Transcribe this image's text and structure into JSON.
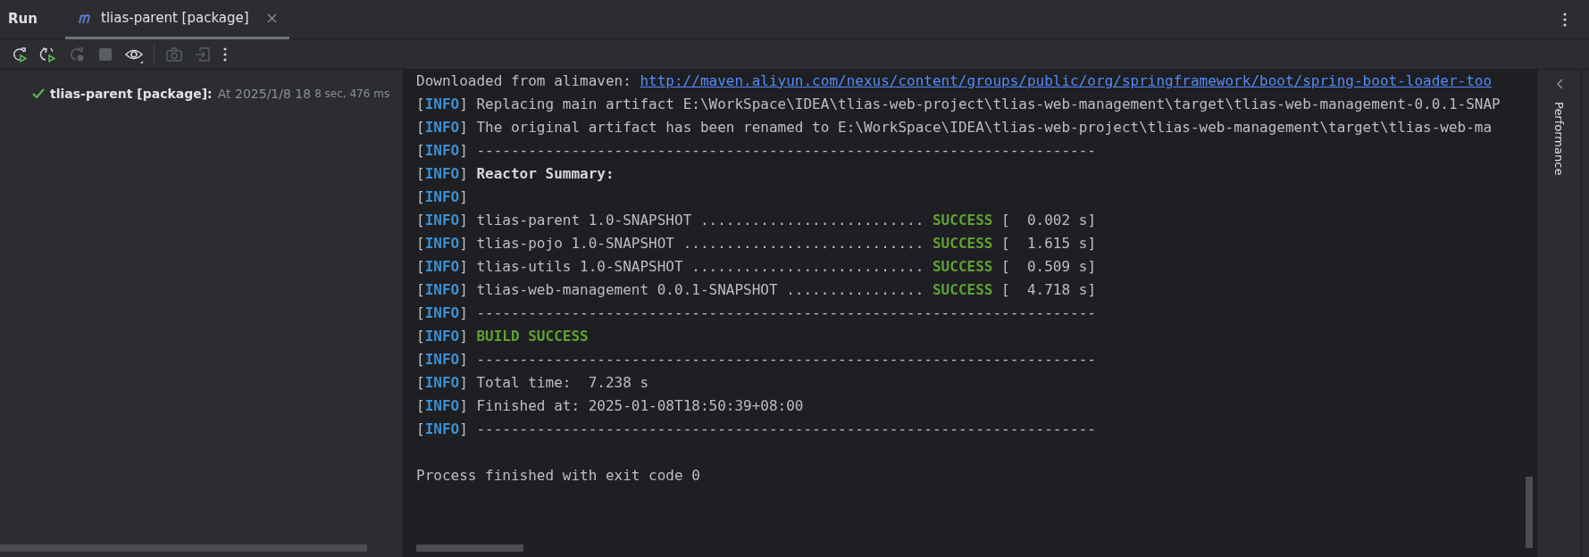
{
  "tool_window": {
    "title": "Run",
    "tabs": [
      {
        "label": "tlias-parent [package]",
        "selected": true
      }
    ]
  },
  "toolbar": [
    {
      "kind": "rerun",
      "disabled": false
    },
    {
      "kind": "rerun-failed",
      "disabled": false
    },
    {
      "kind": "rerun-debug",
      "disabled": true
    },
    {
      "kind": "stop",
      "disabled": true
    },
    {
      "kind": "view",
      "disabled": false
    },
    {
      "kind": "separator"
    },
    {
      "kind": "screenshot",
      "disabled": true
    },
    {
      "kind": "export",
      "disabled": true
    },
    {
      "kind": "more",
      "disabled": false
    }
  ],
  "run_tree": [
    {
      "kind": "success",
      "name": "tlias-parent [package]:",
      "started": "At 2025/1/8 18",
      "duration": "8 sec, 476 ms"
    }
  ],
  "console": {
    "lines": [
      {
        "segments": [
          {
            "kind": "plain",
            "text": "Downloaded from alimaven: "
          },
          {
            "kind": "link",
            "text": "http://maven.aliyun.com/nexus/content/groups/public/org/springframework/boot/spring-boot-loader-too"
          }
        ]
      },
      {
        "segments": [
          {
            "kind": "bracket",
            "text": "["
          },
          {
            "kind": "level",
            "text": "INFO"
          },
          {
            "kind": "bracket",
            "text": "] "
          },
          {
            "kind": "plain",
            "text": "Replacing main artifact E:\\WorkSpace\\IDEA\\tlias-web-project\\tlias-web-management\\target\\tlias-web-management-0.0.1-SNAP"
          }
        ]
      },
      {
        "segments": [
          {
            "kind": "bracket",
            "text": "["
          },
          {
            "kind": "level",
            "text": "INFO"
          },
          {
            "kind": "bracket",
            "text": "] "
          },
          {
            "kind": "plain",
            "text": "The original artifact has been renamed to E:\\WorkSpace\\IDEA\\tlias-web-project\\tlias-web-management\\target\\tlias-web-ma"
          }
        ]
      },
      {
        "segments": [
          {
            "kind": "bracket",
            "text": "["
          },
          {
            "kind": "level",
            "text": "INFO"
          },
          {
            "kind": "bracket",
            "text": "] "
          },
          {
            "kind": "plain",
            "text": "------------------------------------------------------------------------"
          }
        ]
      },
      {
        "segments": [
          {
            "kind": "bracket",
            "text": "["
          },
          {
            "kind": "level",
            "text": "INFO"
          },
          {
            "kind": "bracket",
            "text": "] "
          },
          {
            "kind": "bold",
            "text": "Reactor Summary:"
          }
        ]
      },
      {
        "segments": [
          {
            "kind": "bracket",
            "text": "["
          },
          {
            "kind": "level",
            "text": "INFO"
          },
          {
            "kind": "bracket",
            "text": "]"
          }
        ]
      },
      {
        "segments": [
          {
            "kind": "bracket",
            "text": "["
          },
          {
            "kind": "level",
            "text": "INFO"
          },
          {
            "kind": "bracket",
            "text": "] "
          },
          {
            "kind": "plain",
            "text": "tlias-parent 1.0-SNAPSHOT .......................... "
          },
          {
            "kind": "success",
            "text": "SUCCESS"
          },
          {
            "kind": "plain",
            "text": " [  0.002 s]"
          }
        ]
      },
      {
        "segments": [
          {
            "kind": "bracket",
            "text": "["
          },
          {
            "kind": "level",
            "text": "INFO"
          },
          {
            "kind": "bracket",
            "text": "] "
          },
          {
            "kind": "plain",
            "text": "tlias-pojo 1.0-SNAPSHOT ............................ "
          },
          {
            "kind": "success",
            "text": "SUCCESS"
          },
          {
            "kind": "plain",
            "text": " [  1.615 s]"
          }
        ]
      },
      {
        "segments": [
          {
            "kind": "bracket",
            "text": "["
          },
          {
            "kind": "level",
            "text": "INFO"
          },
          {
            "kind": "bracket",
            "text": "] "
          },
          {
            "kind": "plain",
            "text": "tlias-utils 1.0-SNAPSHOT ........................... "
          },
          {
            "kind": "success",
            "text": "SUCCESS"
          },
          {
            "kind": "plain",
            "text": " [  0.509 s]"
          }
        ]
      },
      {
        "segments": [
          {
            "kind": "bracket",
            "text": "["
          },
          {
            "kind": "level",
            "text": "INFO"
          },
          {
            "kind": "bracket",
            "text": "] "
          },
          {
            "kind": "plain",
            "text": "tlias-web-management 0.0.1-SNAPSHOT ................ "
          },
          {
            "kind": "success",
            "text": "SUCCESS"
          },
          {
            "kind": "plain",
            "text": " [  4.718 s]"
          }
        ]
      },
      {
        "segments": [
          {
            "kind": "bracket",
            "text": "["
          },
          {
            "kind": "level",
            "text": "INFO"
          },
          {
            "kind": "bracket",
            "text": "] "
          },
          {
            "kind": "plain",
            "text": "------------------------------------------------------------------------"
          }
        ]
      },
      {
        "segments": [
          {
            "kind": "bracket",
            "text": "["
          },
          {
            "kind": "level",
            "text": "INFO"
          },
          {
            "kind": "bracket",
            "text": "] "
          },
          {
            "kind": "success",
            "text": "BUILD SUCCESS"
          }
        ]
      },
      {
        "segments": [
          {
            "kind": "bracket",
            "text": "["
          },
          {
            "kind": "level",
            "text": "INFO"
          },
          {
            "kind": "bracket",
            "text": "] "
          },
          {
            "kind": "plain",
            "text": "------------------------------------------------------------------------"
          }
        ]
      },
      {
        "segments": [
          {
            "kind": "bracket",
            "text": "["
          },
          {
            "kind": "level",
            "text": "INFO"
          },
          {
            "kind": "bracket",
            "text": "] "
          },
          {
            "kind": "plain",
            "text": "Total time:  7.238 s"
          }
        ]
      },
      {
        "segments": [
          {
            "kind": "bracket",
            "text": "["
          },
          {
            "kind": "level",
            "text": "INFO"
          },
          {
            "kind": "bracket",
            "text": "] "
          },
          {
            "kind": "plain",
            "text": "Finished at: 2025-01-08T18:50:39+08:00"
          }
        ]
      },
      {
        "segments": [
          {
            "kind": "bracket",
            "text": "["
          },
          {
            "kind": "level",
            "text": "INFO"
          },
          {
            "kind": "bracket",
            "text": "] "
          },
          {
            "kind": "plain",
            "text": "------------------------------------------------------------------------"
          }
        ]
      }
    ],
    "exit_message": "Process finished with exit code 0"
  },
  "side_stripe": {
    "label": "Performance"
  }
}
